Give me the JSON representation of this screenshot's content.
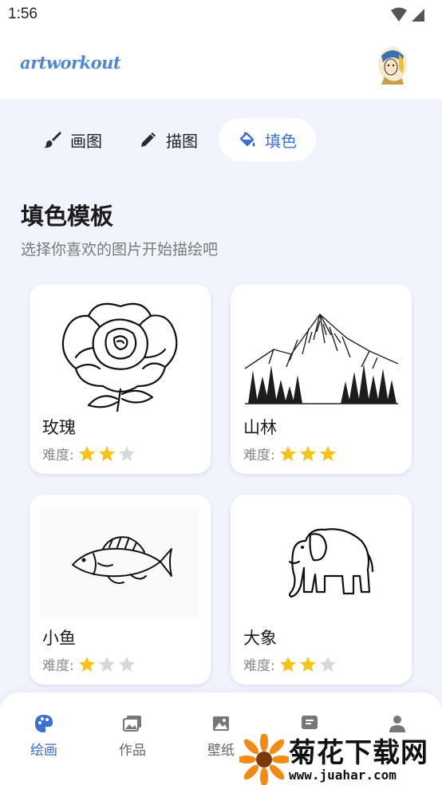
{
  "status_bar": {
    "time": "1:56"
  },
  "app_bar": {
    "logo_text": "artworkout"
  },
  "tabs": [
    {
      "label": "画图",
      "icon": "brush-icon"
    },
    {
      "label": "描图",
      "icon": "pencil-icon"
    },
    {
      "label": "填色",
      "icon": "paint-bucket-icon",
      "active": true
    }
  ],
  "section": {
    "title": "填色模板",
    "subtitle": "选择你喜欢的图片开始描绘吧"
  },
  "difficulty_label": "难度:",
  "templates": [
    {
      "name": "玫瑰",
      "stars": 2,
      "max_stars": 3
    },
    {
      "name": "山林",
      "stars": 3,
      "max_stars": 3
    },
    {
      "name": "小鱼",
      "stars": 1,
      "max_stars": 3
    },
    {
      "name": "大象",
      "stars": 2,
      "max_stars": 3
    }
  ],
  "bottom_nav": [
    {
      "label": "绘画",
      "icon": "palette-icon",
      "active": true
    },
    {
      "label": "作品",
      "icon": "gallery-icon"
    },
    {
      "label": "壁纸",
      "icon": "image-icon"
    },
    {
      "label": "",
      "icon": "message-icon"
    },
    {
      "label": "",
      "icon": "person-icon"
    }
  ],
  "watermark": {
    "text": "菊花下载网",
    "url": "www.juahar.com"
  },
  "colors": {
    "accent": "#3b6fd1",
    "star_on": "#f7c31b",
    "star_off": "#d8d8d8",
    "background": "#f1f3fd"
  }
}
